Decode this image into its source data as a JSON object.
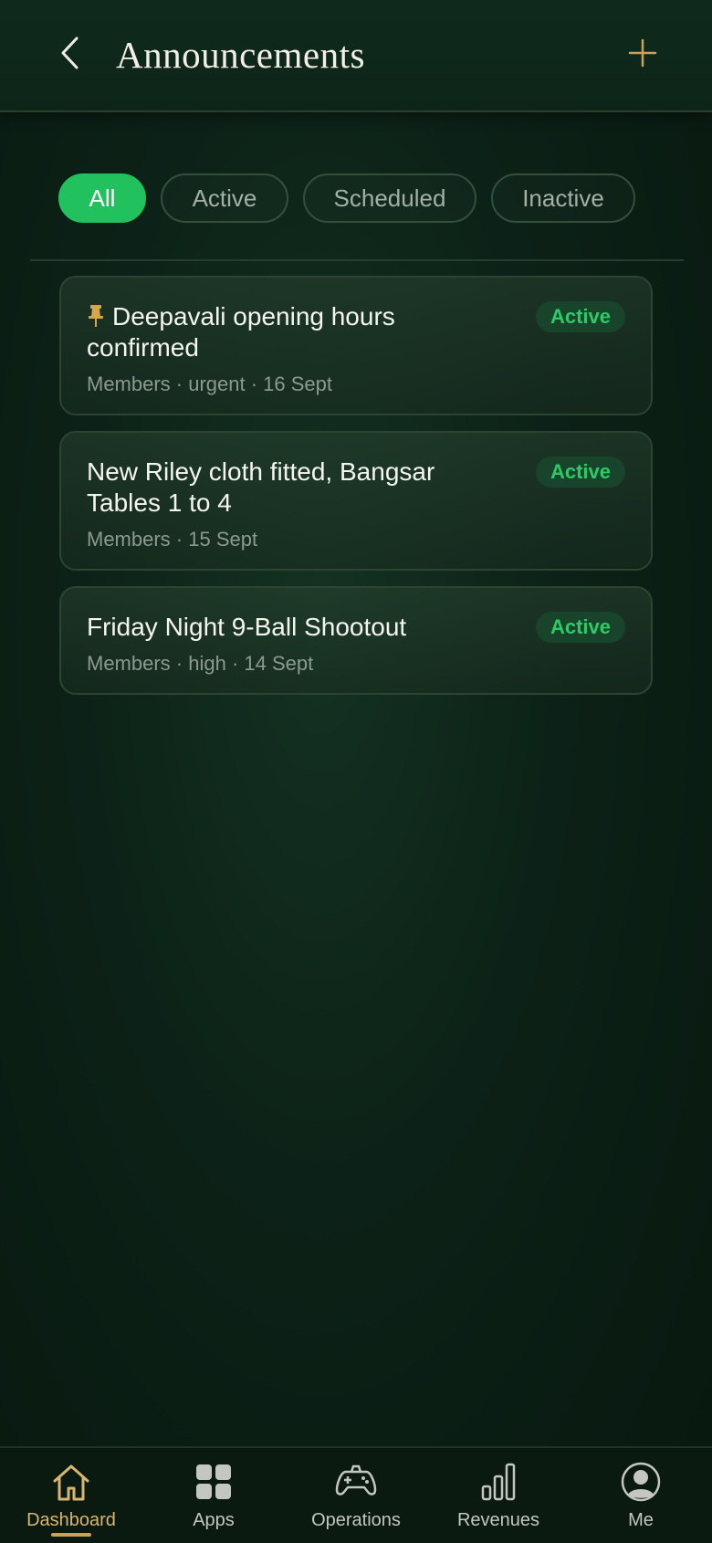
{
  "header": {
    "title": "Announcements",
    "back_icon": "chevron-left-icon",
    "add_icon": "plus-icon"
  },
  "filters": [
    {
      "label": "All",
      "selected": true
    },
    {
      "label": "Active",
      "selected": false
    },
    {
      "label": "Scheduled",
      "selected": false
    },
    {
      "label": "Inactive",
      "selected": false
    }
  ],
  "announcements": [
    {
      "title": "Deepavali opening hours confirmed",
      "meta": "Members · urgent · 16 Sept",
      "status": "Active",
      "pinned": true
    },
    {
      "title": "New Riley cloth fitted, Bangsar Tables 1 to 4",
      "meta": "Members · 15 Sept",
      "status": "Active",
      "pinned": false
    },
    {
      "title": "Friday Night 9-Ball Shootout",
      "meta": "Members · high · 14 Sept",
      "status": "Active",
      "pinned": false
    }
  ],
  "tabbar": {
    "items": [
      {
        "label": "Dashboard",
        "icon": "home-icon",
        "active": true
      },
      {
        "label": "Apps",
        "icon": "apps-grid-icon",
        "active": false
      },
      {
        "label": "Operations",
        "icon": "gamepad-icon",
        "active": false
      },
      {
        "label": "Revenues",
        "icon": "bar-chart-icon",
        "active": false
      },
      {
        "label": "Me",
        "icon": "user-avatar-icon",
        "active": false
      }
    ]
  },
  "colors": {
    "accent_green": "#21c25d",
    "gold": "#d9b56e",
    "background": "#0c2117"
  }
}
